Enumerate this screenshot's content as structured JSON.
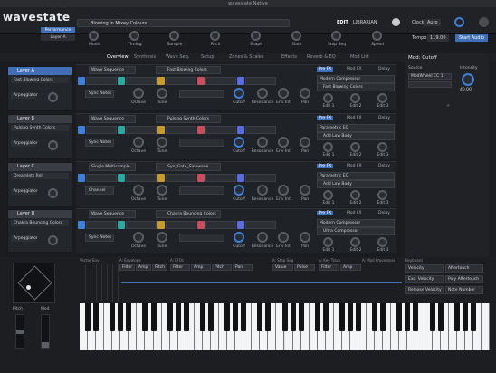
{
  "window_title": "wavestate Native",
  "app_logo": "wavestate",
  "preset_name": "Blowing in Mixey Colours",
  "header": {
    "edit": "EDIT",
    "librarian": "LIBRARIAN",
    "clock": "Clock",
    "clock_value": "Auto",
    "tempo": "Tempo",
    "tempo_value": "119.00",
    "start_audio": "Start Audio",
    "performance": "Performance",
    "layer": "Layer A"
  },
  "macros": [
    "Mods",
    "Timing",
    "Sample",
    "Pitch",
    "Shape",
    "Gate",
    "Step Seq",
    "Speed"
  ],
  "tabs": [
    "Overview",
    "Synthesis",
    "Wave Seq.",
    "Setup",
    "Zones & Scales",
    "Effects",
    "Reverb & EQ",
    "Mod List"
  ],
  "layers": [
    {
      "name": "Layer A",
      "preset": "Fast Blowing Colors",
      "arp": "Arpeggiator"
    },
    {
      "name": "Layer B",
      "preset": "Pulsing Synth Colors",
      "arp": "Arpeggiator"
    },
    {
      "name": "Layer C",
      "preset": "Dreamlets Rel",
      "arp": "Arpeggiator"
    },
    {
      "name": "Layer D",
      "preset": "Chakra Bouncing Colors",
      "arp": "Arpeggiator"
    }
  ],
  "rows": [
    {
      "mode": "Wave Sequence",
      "wave": "Fast Blowing Colors",
      "sync": "Sync Notes",
      "labels": [
        "Octave",
        "Tune",
        "Cutoff",
        "Resonance",
        "Env Int",
        "Pan"
      ],
      "fx1": "Pre FX",
      "fx2": "Mod FX",
      "fx3": "Delay",
      "fxa": "Modern Compressor",
      "fxb": "Fast Blowing Colors",
      "sends": [
        "Edit 1",
        "Edit 2",
        "Edit 3"
      ]
    },
    {
      "mode": "Wave Sequence",
      "wave": "Pulsing Synth Colors",
      "sync": "Sync Notes",
      "labels": [
        "Octave",
        "Tune",
        "Cutoff",
        "Resonance",
        "Env Int",
        "Pan"
      ],
      "fx1": "Pre FX",
      "fx2": "Mod FX",
      "fx3": "Delay",
      "fxa": "Parametric EQ",
      "fxb": "Add Low Body",
      "sends": [
        "Edit 1",
        "Edit 2",
        "Edit 3"
      ]
    },
    {
      "mode": "Single Multisample",
      "wave": "Syn_Gate_Sinewave",
      "sync": "Channel",
      "labels": [
        "Octave",
        "Tune",
        "Cutoff",
        "Resonance",
        "Env Int",
        "Pan"
      ],
      "fx1": "Pre FX",
      "fx2": "Mod FX",
      "fx3": "Delay",
      "fxa": "Parametric EQ",
      "fxb": "Add Low Body",
      "sends": [
        "Edit 1",
        "Edit 2",
        "Edit 3"
      ]
    },
    {
      "mode": "Wave Sequence",
      "wave": "Chakra Bouncing Colors",
      "sync": "Sync Notes",
      "labels": [
        "Octave",
        "Tune",
        "Cutoff",
        "Resonance",
        "Env Int",
        "Pan"
      ],
      "fx1": "Pre FX",
      "fx2": "Mod FX",
      "fx3": "Delay",
      "fxa": "Modern Compressor",
      "fxb": "Ultra Compressor",
      "sends": [
        "Edit 1",
        "Edit 2",
        "Edit 3"
      ]
    }
  ],
  "mod_cutoff": {
    "title": "Mod: Cutoff",
    "source": "Source",
    "intensity": "Intensity",
    "src_value": "ModWheel CC 1",
    "int_value": "40.00"
  },
  "bottom": {
    "vector_env": "Vector Env",
    "envelope": "A: Envelope",
    "lfo": "A: LFOs",
    "step_seq": "A: Step Seq",
    "key_track": "A: Key Track",
    "mod_processors": "A: Mod Processors",
    "keyboard": "Keyboard",
    "pitch": "Pitch",
    "mod": "Mod"
  },
  "keyboard_items": [
    "Velocity",
    "Aftertouch",
    "Exc. Velocity",
    "Poly Aftertouch",
    "Release Velocity",
    "Note Number"
  ],
  "env_tabs": [
    "Filter",
    "Amp",
    "Pitch"
  ],
  "lfo_tabs": [
    "Filter",
    "Amp",
    "Pitch",
    "Pan"
  ],
  "seq_tabs": [
    "Value",
    "Pulse"
  ],
  "key_tabs": [
    "Filter",
    "Amp"
  ]
}
